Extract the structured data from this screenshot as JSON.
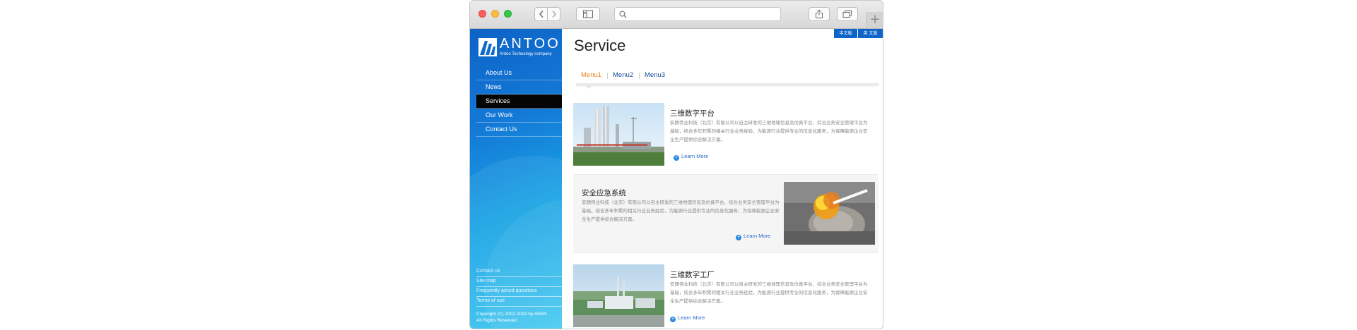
{
  "window": {
    "search_placeholder": ""
  },
  "sidebar": {
    "logo_text": "ANTOO",
    "logo_subtitle": "Antoo Technology company",
    "items": [
      {
        "label": "About Us"
      },
      {
        "label": "News"
      },
      {
        "label": "Services",
        "active": true
      },
      {
        "label": "Our Work"
      },
      {
        "label": "Contact Us"
      }
    ],
    "footer_links": [
      {
        "label": "Contact us"
      },
      {
        "label": "Site map"
      },
      {
        "label": "Frequently asked questions"
      },
      {
        "label": "Terms of use"
      }
    ],
    "copyright_line1": "Copyright (C) 2002-2019 by ANSN",
    "copyright_line2": "All Rights Reserved."
  },
  "lang": {
    "cn": "中文版",
    "en": "英 文版"
  },
  "main": {
    "title": "Service",
    "tabs": [
      {
        "label": "Menu1",
        "active": true
      },
      {
        "label": "Menu2"
      },
      {
        "label": "Menu3"
      }
    ],
    "cards": [
      {
        "title": "三维数字平台",
        "desc": "安朗伟业科技（北京）有限公司以自主研发的三维地理信息及仿真平台、综合业务安全管理平台为基础，结合多年积累的相关行业业务经验，为能源行业提供专业的信息化服务，为保障能源企业安全生产提供综合解决方案。",
        "learn_more": "Learn More"
      },
      {
        "title": "安全应急系统",
        "desc": "安朗伟业科技（北京）有限公司以自主研发的三维地理信息及仿真平台、综合业务安全管理平台为基础，结合多年积累的相关行业业务经验，为能源行业提供专业的信息化服务，为保障能源企业安全生产提供综合解决方案。",
        "learn_more": "Learn More"
      },
      {
        "title": "三维数字工厂",
        "desc": "安朗伟业科技（北京）有限公司以自主研发的三维地理信息及仿真平台、综合业务安全管理平台为基础，结合多年积累的相关行业业务经验，为能源行业提供专业的信息化服务，为保障能源企业安全生产提供综合解决方案。",
        "learn_more": "Learn More"
      }
    ]
  }
}
